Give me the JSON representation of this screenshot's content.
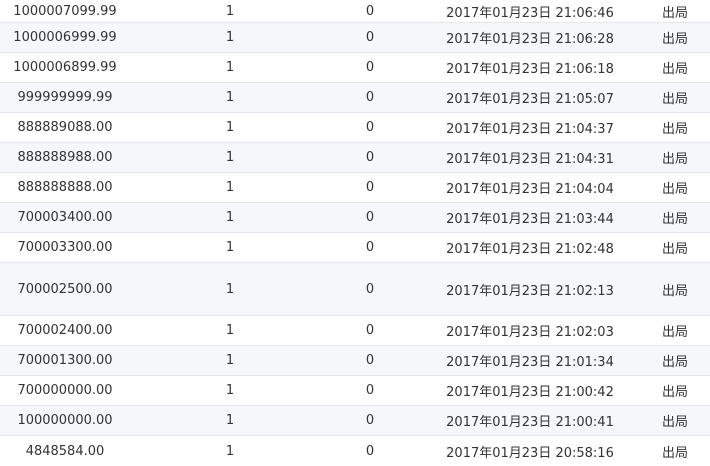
{
  "rows": [
    {
      "amount": "1000007099.99",
      "a": "1",
      "b": "0",
      "time": "2017年01月23日 21:06:46",
      "status": "出局"
    },
    {
      "amount": "1000006999.99",
      "a": "1",
      "b": "0",
      "time": "2017年01月23日 21:06:28",
      "status": "出局"
    },
    {
      "amount": "1000006899.99",
      "a": "1",
      "b": "0",
      "time": "2017年01月23日 21:06:18",
      "status": "出局"
    },
    {
      "amount": "999999999.99",
      "a": "1",
      "b": "0",
      "time": "2017年01月23日 21:05:07",
      "status": "出局"
    },
    {
      "amount": "888889088.00",
      "a": "1",
      "b": "0",
      "time": "2017年01月23日 21:04:37",
      "status": "出局"
    },
    {
      "amount": "888888988.00",
      "a": "1",
      "b": "0",
      "time": "2017年01月23日 21:04:31",
      "status": "出局"
    },
    {
      "amount": "888888888.00",
      "a": "1",
      "b": "0",
      "time": "2017年01月23日 21:04:04",
      "status": "出局"
    },
    {
      "amount": "700003400.00",
      "a": "1",
      "b": "0",
      "time": "2017年01月23日 21:03:44",
      "status": "出局"
    },
    {
      "amount": "700003300.00",
      "a": "1",
      "b": "0",
      "time": "2017年01月23日 21:02:48",
      "status": "出局"
    },
    {
      "amount": "700002500.00",
      "a": "1",
      "b": "0",
      "time": "2017年01月23日 21:02:13",
      "status": "出局"
    },
    {
      "amount": "700002400.00",
      "a": "1",
      "b": "0",
      "time": "2017年01月23日 21:02:03",
      "status": "出局"
    },
    {
      "amount": "700001300.00",
      "a": "1",
      "b": "0",
      "time": "2017年01月23日 21:01:34",
      "status": "出局"
    },
    {
      "amount": "700000000.00",
      "a": "1",
      "b": "0",
      "time": "2017年01月23日 21:00:42",
      "status": "出局"
    },
    {
      "amount": "100000000.00",
      "a": "1",
      "b": "0",
      "time": "2017年01月23日 21:00:41",
      "status": "出局"
    },
    {
      "amount": "4848584.00",
      "a": "1",
      "b": "0",
      "time": "2017年01月23日 20:58:16",
      "status": "出局"
    }
  ]
}
